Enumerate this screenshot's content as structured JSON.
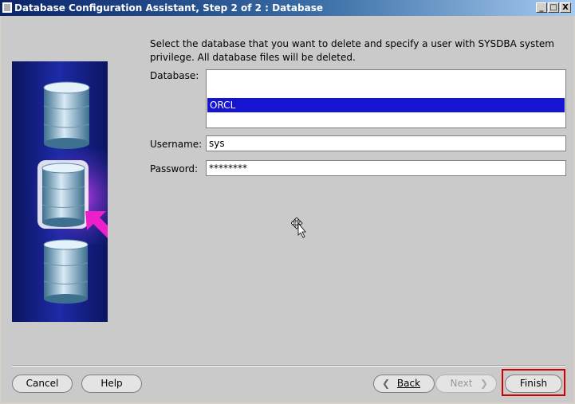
{
  "window": {
    "title": "Database Configuration Assistant, Step 2 of 2 : Database",
    "controls": {
      "minimize": "_",
      "maximize": "□",
      "close": "X"
    }
  },
  "instructions": "Select the database that you want to delete and specify a user with SYSDBA system privilege. All database files will be deleted.",
  "form": {
    "database_label": "Database:",
    "databases": [
      "ORCL"
    ],
    "selected_database": "ORCL",
    "username_label": "Username:",
    "username_value": "sys",
    "password_label": "Password:",
    "password_value": "********"
  },
  "buttons": {
    "cancel": "Cancel",
    "help": "Help",
    "back": "Back",
    "next": "Next",
    "finish": "Finish"
  },
  "colors": {
    "title_bar_start": "#0a246a",
    "selection": "#1414d2",
    "illustration_bg": "#0d1a6e",
    "arrow": "#ee1ec8",
    "highlight_frame": "#d00000"
  },
  "icons": [
    "database-cylinder-icon",
    "magenta-arrow-icon",
    "move-cursor-icon",
    "left-arrow-icon",
    "right-arrow-icon"
  ]
}
